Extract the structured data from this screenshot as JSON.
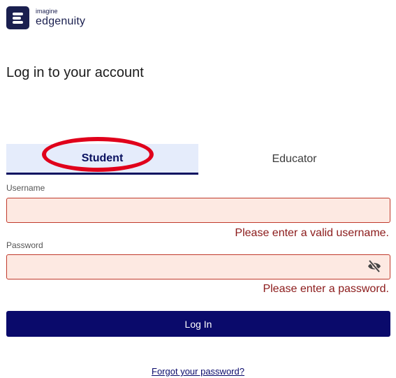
{
  "brand": {
    "small": "imagine",
    "name": "edgenuity",
    "color": "#1a1f4f"
  },
  "page_title": "Log in to your account",
  "tabs": [
    {
      "label": "Student",
      "selected": true
    },
    {
      "label": "Educator",
      "selected": false
    }
  ],
  "username": {
    "label": "Username",
    "value": "",
    "error": "Please enter a valid username."
  },
  "password": {
    "label": "Password",
    "value": "",
    "error": "Please enter a password.",
    "visibility_icon": "eye-off-icon"
  },
  "login_button": "Log In",
  "forgot_link": "Forgot your password?",
  "colors": {
    "accent": "#0a0a6b",
    "error_text": "#8b1a1a",
    "error_field": "#fde9e2",
    "tab_selected_bg": "#e5ecfb",
    "annotation_ring": "#e0001b"
  }
}
